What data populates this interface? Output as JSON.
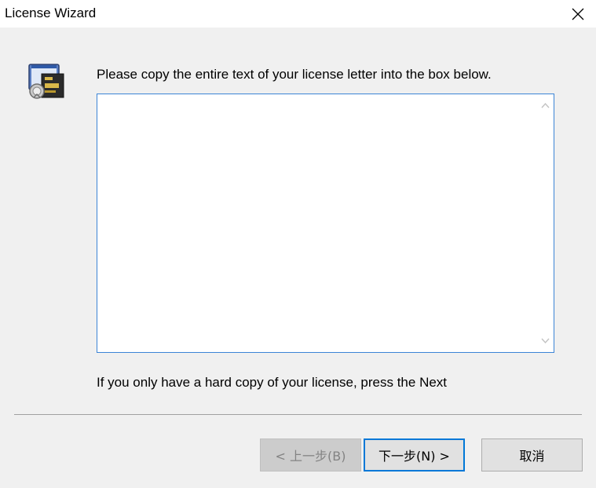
{
  "window": {
    "title": "License Wizard"
  },
  "content": {
    "instruction": "Please copy the entire text of your license letter into the box below.",
    "license_text": "",
    "hint": "If you only have a hard copy of your license, press the Next"
  },
  "buttons": {
    "back": "< 上一步(B)",
    "next": "下一步(N) >",
    "cancel": "取消"
  },
  "colors": {
    "accent": "#0078d7",
    "textbox_border": "#3c84d6",
    "dialog_bg": "#f0f0f0"
  },
  "icons": {
    "wizard": "license-certificate-icon",
    "close": "close-icon",
    "scroll_up": "chevron-up-icon",
    "scroll_down": "chevron-down-icon"
  }
}
